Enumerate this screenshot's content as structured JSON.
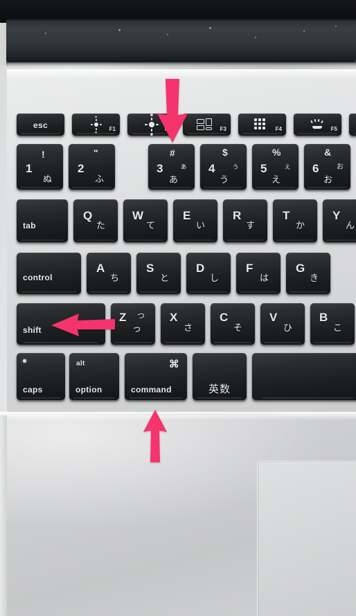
{
  "scene": {
    "subject": "MacBook JIS Japanese keyboard close-up photo",
    "annotation_color": "#F5336C",
    "key_face_color": "#242628",
    "chassis_color": "#D2D3D4"
  },
  "keyboard": {
    "function_row": [
      {
        "name": "esc",
        "label": "esc",
        "icon": null,
        "fkey": ""
      },
      {
        "name": "f1",
        "label": "",
        "icon": "brightness-down-icon",
        "fkey": "F1"
      },
      {
        "name": "f2",
        "label": "",
        "icon": "brightness-up-icon",
        "fkey": "F2"
      },
      {
        "name": "f3",
        "label": "",
        "icon": "mission-control-icon",
        "fkey": "F3"
      },
      {
        "name": "f4",
        "label": "",
        "icon": "launchpad-icon",
        "fkey": "F4"
      },
      {
        "name": "f5",
        "label": "",
        "icon": "keyboard-backlight-down-icon",
        "fkey": "F5"
      },
      {
        "name": "f6",
        "label": "",
        "icon": null,
        "fkey": ""
      }
    ],
    "number_row": [
      {
        "name": "1",
        "primary": "1",
        "shift": "!",
        "kana_top": "",
        "kana_bottom": "ぬ"
      },
      {
        "name": "2",
        "primary": "2",
        "shift": "\"",
        "kana_top": "",
        "kana_bottom": "ふ"
      },
      {
        "name": "3",
        "primary": "3",
        "shift": "#",
        "kana_top": "ぁ",
        "kana_bottom": "あ"
      },
      {
        "name": "4",
        "primary": "4",
        "shift": "$",
        "kana_top": "ぅ",
        "kana_bottom": "う"
      },
      {
        "name": "5",
        "primary": "5",
        "shift": "%",
        "kana_top": "ぇ",
        "kana_bottom": "え"
      },
      {
        "name": "6",
        "primary": "6",
        "shift": "&",
        "kana_top": "お",
        "kana_bottom": "お"
      }
    ],
    "qwerty_row": [
      {
        "name": "tab",
        "primary": "tab",
        "kana": ""
      },
      {
        "name": "q",
        "primary": "Q",
        "kana": "た"
      },
      {
        "name": "w",
        "primary": "W",
        "kana": "て"
      },
      {
        "name": "e",
        "primary": "E",
        "kana": "い"
      },
      {
        "name": "r",
        "primary": "R",
        "kana": "す"
      },
      {
        "name": "t",
        "primary": "T",
        "kana": "か"
      },
      {
        "name": "y",
        "primary": "Y",
        "kana": "ん"
      }
    ],
    "home_row": [
      {
        "name": "control",
        "primary": "control",
        "kana": ""
      },
      {
        "name": "a",
        "primary": "A",
        "kana": "ち"
      },
      {
        "name": "s",
        "primary": "S",
        "kana": "と"
      },
      {
        "name": "d",
        "primary": "D",
        "kana": "し"
      },
      {
        "name": "f",
        "primary": "F",
        "kana": "は"
      },
      {
        "name": "g",
        "primary": "G",
        "kana": "き"
      }
    ],
    "shift_row": [
      {
        "name": "shift",
        "primary": "shift",
        "kana": ""
      },
      {
        "name": "z",
        "primary": "Z",
        "kana": "っ",
        "kana_top": "つ"
      },
      {
        "name": "x",
        "primary": "X",
        "kana": "さ",
        "kana_top": ""
      },
      {
        "name": "c",
        "primary": "C",
        "kana": "そ",
        "kana_top": ""
      },
      {
        "name": "v",
        "primary": "V",
        "kana": "ひ",
        "kana_top": ""
      },
      {
        "name": "b",
        "primary": "B",
        "kana": "こ",
        "kana_top": ""
      }
    ],
    "bottom_row": [
      {
        "name": "caps",
        "label": "caps",
        "sub": "",
        "symbol": "",
        "has_led": true
      },
      {
        "name": "option",
        "label": "option",
        "sub": "alt",
        "symbol": "",
        "has_led": false
      },
      {
        "name": "command",
        "label": "command",
        "sub": "",
        "symbol": "⌘",
        "has_led": false
      },
      {
        "name": "eisu",
        "label": "英数",
        "sub": "",
        "symbol": "",
        "has_led": false
      },
      {
        "name": "space",
        "label": "",
        "sub": "",
        "symbol": "",
        "has_led": false
      }
    ]
  },
  "annotations": [
    {
      "name": "arrow-to-f3-key",
      "direction": "down",
      "target": "F3 / number-3 key area"
    },
    {
      "name": "arrow-to-shift-key",
      "direction": "left",
      "target": "shift key"
    },
    {
      "name": "arrow-to-command-key",
      "direction": "up",
      "target": "command key"
    }
  ],
  "trackpad": {
    "name": "trackpad"
  }
}
